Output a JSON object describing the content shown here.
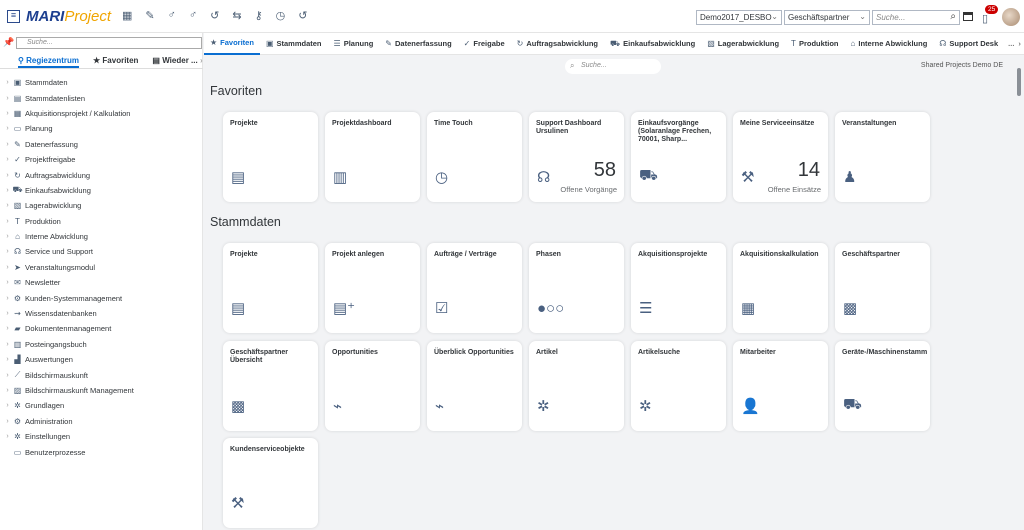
{
  "header": {
    "brand_main": "MARI",
    "brand_sub": "Project",
    "client": "Demo2017_DESBO",
    "object_type": "Geschäftspartner",
    "search_placeholder": "Suche...",
    "notification_count": "25",
    "quick_icons": [
      "grid-icon",
      "edit-icon",
      "user-add-icon",
      "user-list-icon",
      "history-icon",
      "transfer-icon",
      "key-icon",
      "timer-icon",
      "history2-icon"
    ]
  },
  "sidebar": {
    "search_placeholder": "Suche...",
    "tabs": [
      "Regiezentrum",
      "Favoriten",
      "Wieder"
    ],
    "more": "...",
    "items": [
      {
        "label": "Stammdaten",
        "icon": "▣"
      },
      {
        "label": "Stammdatenlisten",
        "icon": "▤"
      },
      {
        "label": "Akquisitionsprojekt / Kalkulation",
        "icon": "▦"
      },
      {
        "label": "Planung",
        "icon": "▭"
      },
      {
        "label": "Datenerfassung",
        "icon": "✎"
      },
      {
        "label": "Projektfreigabe",
        "icon": "✓"
      },
      {
        "label": "Auftragsabwicklung",
        "icon": "↻"
      },
      {
        "label": "Einkaufsabwicklung",
        "icon": "⛟"
      },
      {
        "label": "Lagerabwicklung",
        "icon": "▧"
      },
      {
        "label": "Produktion",
        "icon": "T"
      },
      {
        "label": "Interne Abwicklung",
        "icon": "⌂"
      },
      {
        "label": "Service und Support",
        "icon": "☊"
      },
      {
        "label": "Veranstaltungsmodul",
        "icon": "➤"
      },
      {
        "label": "Newsletter",
        "icon": "✉"
      },
      {
        "label": "Kunden-Systemmanagement",
        "icon": "⚙"
      },
      {
        "label": "Wissensdatenbanken",
        "icon": "⇝"
      },
      {
        "label": "Dokumentenmanagement",
        "icon": "▰"
      },
      {
        "label": "Posteingangsbuch",
        "icon": "▥"
      },
      {
        "label": "Auswertungen",
        "icon": "▟"
      },
      {
        "label": "Bildschirmauskunft",
        "icon": "⟋"
      },
      {
        "label": "Bildschirmauskunft Management",
        "icon": "▨"
      },
      {
        "label": "Grundlagen",
        "icon": "✲"
      },
      {
        "label": "Administration",
        "icon": "⚙"
      },
      {
        "label": "Einstellungen",
        "icon": "✲"
      },
      {
        "label": "Benutzerprozesse",
        "icon": "▭",
        "leaf": true
      }
    ]
  },
  "tabs": [
    {
      "label": "Favoriten",
      "icon": "★"
    },
    {
      "label": "Stammdaten",
      "icon": "▣"
    },
    {
      "label": "Planung",
      "icon": "☰"
    },
    {
      "label": "Datenerfassung",
      "icon": "✎"
    },
    {
      "label": "Freigabe",
      "icon": "✓"
    },
    {
      "label": "Auftragsabwicklung",
      "icon": "↻"
    },
    {
      "label": "Einkaufsabwicklung",
      "icon": "⛟"
    },
    {
      "label": "Lagerabwicklung",
      "icon": "▧"
    },
    {
      "label": "Produktion",
      "icon": "T"
    },
    {
      "label": "Interne Abwicklung",
      "icon": "⌂"
    },
    {
      "label": "Support Desk",
      "icon": "☊"
    }
  ],
  "tabs_more": "...",
  "content": {
    "search_placeholder": "Suche...",
    "shared": "Shared Projects Demo DE",
    "sections": [
      {
        "title": "Favoriten",
        "tiles": [
          {
            "title": "Projekte",
            "icon": "▤"
          },
          {
            "title": "Projektdashboard",
            "icon": "▥"
          },
          {
            "title": "Time Touch",
            "icon": "◷"
          },
          {
            "title": "Support Dashboard Ursulinen",
            "icon": "☊",
            "number": "58",
            "unit": "Offene Vorgänge"
          },
          {
            "title": "Einkaufsvorgänge (Solaranlage Frechen, 70001, Sharp...",
            "icon": "⛟"
          },
          {
            "title": "Meine Serviceeinsätze",
            "icon": "⚒",
            "number": "14",
            "unit": "Offene Einsätze"
          },
          {
            "title": "Veranstaltungen",
            "icon": "♟"
          }
        ]
      },
      {
        "title": "Stammdaten",
        "tiles": [
          {
            "title": "Projekte",
            "icon": "▤"
          },
          {
            "title": "Projekt anlegen",
            "icon": "▤⁺"
          },
          {
            "title": "Aufträge / Verträge",
            "icon": "☑"
          },
          {
            "title": "Phasen",
            "icon": "●○○"
          },
          {
            "title": "Akquisitionsprojekte",
            "icon": "☰"
          },
          {
            "title": "Akquisitionskalkulation",
            "icon": "▦"
          },
          {
            "title": "Geschäftspartner",
            "icon": "▩"
          },
          {
            "title": "Geschäftspartner Übersicht",
            "icon": "▩"
          },
          {
            "title": "Opportunities",
            "icon": "⌁"
          },
          {
            "title": "Überblick Opportunities",
            "icon": "⌁"
          },
          {
            "title": "Artikel",
            "icon": "✲"
          },
          {
            "title": "Artikelsuche",
            "icon": "✲"
          },
          {
            "title": "Mitarbeiter",
            "icon": "👤"
          },
          {
            "title": "Geräte-/Maschinenstamm",
            "icon": "⛟"
          },
          {
            "title": "Kundenserviceobjekte",
            "icon": "⚒"
          }
        ]
      }
    ]
  }
}
